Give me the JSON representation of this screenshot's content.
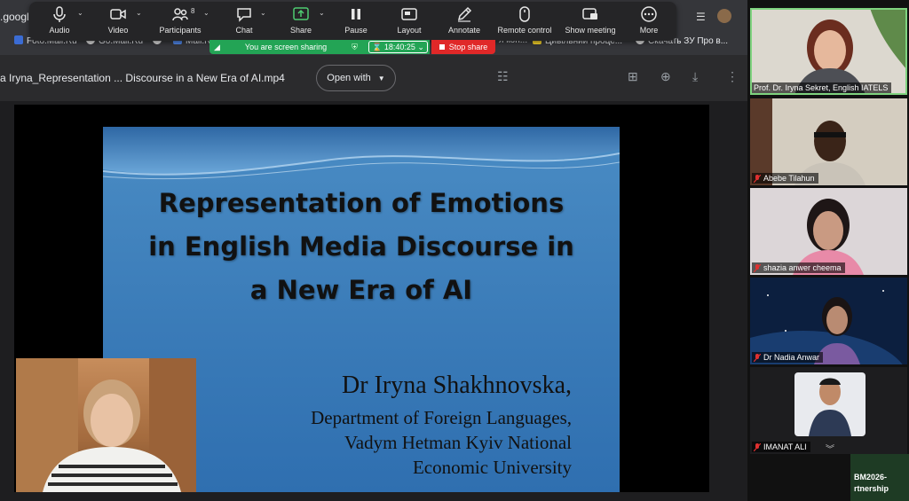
{
  "browser": {
    "url_fragment": ".googl",
    "bookmarks": [
      {
        "label": "Foto.Mail.Ru",
        "icon": "mailru-icon"
      },
      {
        "label": "Go.Mail.Ru",
        "icon": "github-icon"
      },
      {
        "label": "Mail.R",
        "icon": "mail-icon"
      },
      {
        "label": "я кон...",
        "icon": "folder-icon"
      },
      {
        "label": "Цивільний проце...",
        "icon": "flag-icon"
      },
      {
        "label": "Скачать ЗУ Про в...",
        "icon": "github-icon"
      }
    ]
  },
  "toolbar": {
    "items": [
      {
        "label": "Audio",
        "icon": "microphone-icon"
      },
      {
        "label": "Video",
        "icon": "video-camera-icon"
      },
      {
        "label": "Participants",
        "icon": "participants-icon",
        "count": "8"
      },
      {
        "label": "Chat",
        "icon": "chat-icon"
      },
      {
        "label": "Share",
        "icon": "share-screen-icon"
      },
      {
        "label": "Pause",
        "icon": "pause-icon"
      },
      {
        "label": "Layout",
        "icon": "layout-icon"
      },
      {
        "label": "Annotate",
        "icon": "pencil-icon"
      },
      {
        "label": "Remote control",
        "icon": "mouse-icon"
      },
      {
        "label": "Show meeting",
        "icon": "show-meeting-icon"
      },
      {
        "label": "More",
        "icon": "more-dots-icon"
      }
    ]
  },
  "share_status": {
    "message": "You are screen sharing",
    "timer": "18:40:25",
    "stop_label": "Stop share"
  },
  "viewer": {
    "file_name": "a Iryna_Representation ... Discourse in a New Era of AI.mp4",
    "open_with": "Open with"
  },
  "slide": {
    "title_lines": [
      "Representation of Emotions",
      "in English Media Discourse in",
      "a New Era of AI"
    ],
    "author": "Dr Iryna Shakhnovska,",
    "affiliation_lines": [
      "Department of Foreign Languages,",
      "Vadym Hetman Kyiv National",
      "Economic University"
    ]
  },
  "gallery": {
    "participants": [
      {
        "name": "Prof. Dr. Iryna Sekret, English IATELS",
        "muted": false,
        "active": true,
        "bg": "#d9d3c9"
      },
      {
        "name": "Abebe Tilahun",
        "muted": true,
        "active": false,
        "bg": "#d8d1c4"
      },
      {
        "name": "shazia anwer cheema",
        "muted": true,
        "active": false,
        "bg": "#d9d3d5"
      },
      {
        "name": "Dr Nadia Anwar",
        "muted": true,
        "active": false,
        "bg": "#0e2548"
      },
      {
        "name": "IMANAT ALI",
        "muted": true,
        "active": false,
        "bg": "#1d1d1f"
      }
    ],
    "corner_text_lines": [
      "BM2026-",
      "rtnership"
    ]
  },
  "colors": {
    "share_green": "#23a455",
    "stop_red": "#e02828",
    "active_speaker": "#7fd37f"
  }
}
